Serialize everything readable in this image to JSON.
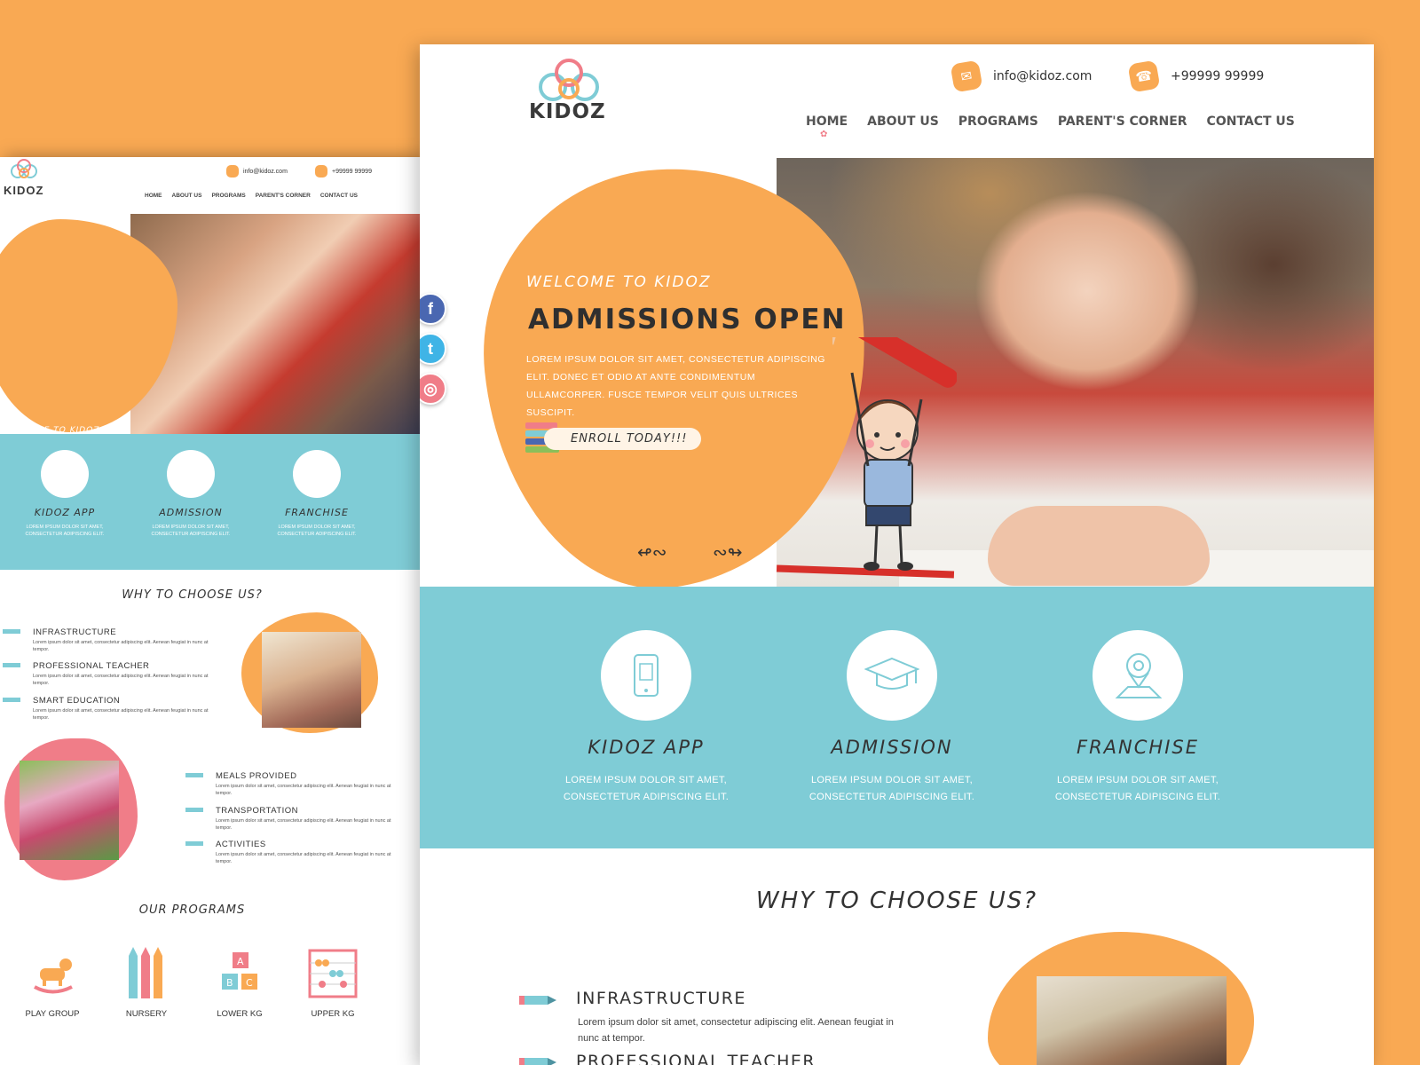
{
  "brand": {
    "name": "KIDOZ",
    "colors": {
      "accent": "#f9a953",
      "teal": "#7fccd6",
      "pink": "#f07d88"
    }
  },
  "contact": {
    "email": "info@kidoz.com",
    "phone": "+99999 99999",
    "email_icon": "mail-icon",
    "phone_icon": "phone-icon"
  },
  "nav": [
    {
      "label": "HOME",
      "active": true
    },
    {
      "label": "ABOUT US"
    },
    {
      "label": "PROGRAMS"
    },
    {
      "label": "PARENT'S CORNER"
    },
    {
      "label": "CONTACT US"
    }
  ],
  "hero": {
    "welcome": "WELCOME TO KIDOZ",
    "title": "ADMISSIONS OPEN",
    "description": "LOREM IPSUM DOLOR SIT AMET, CONSECTETUR ADIPISCING ELIT. DONEC ET ODIO AT ANTE CONDIMENTUM ULLAMCORPER. FUSCE TEMPOR VELIT QUIS ULTRICES SUSCIPIT.",
    "cta": "ENROLL TODAY!!!"
  },
  "social": [
    {
      "name": "facebook-icon",
      "glyph": "f",
      "color": "#4a67b1"
    },
    {
      "name": "twitter-icon",
      "glyph": "t",
      "color": "#3fb4e6"
    },
    {
      "name": "instagram-icon",
      "glyph": "◎",
      "color": "#f07d88"
    }
  ],
  "features": [
    {
      "title": "KIDOZ APP",
      "desc": "LOREM IPSUM DOLOR SIT AMET, CONSECTETUR ADIPISCING ELIT.",
      "icon": "mobile-app-icon"
    },
    {
      "title": "ADMISSION",
      "desc": "LOREM IPSUM DOLOR SIT AMET, CONSECTETUR ADIPISCING ELIT.",
      "icon": "graduation-cap-icon"
    },
    {
      "title": "FRANCHISE",
      "desc": "LOREM IPSUM DOLOR SIT AMET, CONSECTETUR ADIPISCING ELIT.",
      "icon": "map-pin-icon"
    }
  ],
  "why": {
    "title": "WHY TO CHOOSE US?",
    "items": [
      {
        "title": "INFRASTRUCTURE",
        "desc": "Lorem ipsum dolor sit amet, consectetur adipiscing elit. Aenean feugiat in nunc at tempor."
      },
      {
        "title": "PROFESSIONAL TEACHER",
        "desc": "Lorem ipsum dolor sit amet, consectetur adipiscing elit. Aenean feugiat in nunc at tempor."
      },
      {
        "title": "SMART EDUCATION",
        "desc": "Lorem ipsum dolor sit amet, consectetur adipiscing elit. Aenean feugiat in nunc at tempor."
      },
      {
        "title": "MEALS PROVIDED",
        "desc": "Lorem ipsum dolor sit amet, consectetur adipiscing elit. Aenean feugiat in nunc at tempor."
      },
      {
        "title": "TRANSPORTATION",
        "desc": "Lorem ipsum dolor sit amet, consectetur adipiscing elit. Aenean feugiat in nunc at tempor."
      },
      {
        "title": "ACTIVITIES",
        "desc": "Lorem ipsum dolor sit amet, consectetur adipiscing elit. Aenean feugiat in nunc at tempor."
      }
    ]
  },
  "programs": {
    "title": "OUR PROGRAMS",
    "items": [
      {
        "label": "PLAY GROUP",
        "icon": "rocking-horse-icon"
      },
      {
        "label": "NURSERY",
        "icon": "crayons-icon"
      },
      {
        "label": "LOWER KG",
        "icon": "abc-blocks-icon"
      },
      {
        "label": "UPPER KG",
        "icon": "abacus-icon"
      }
    ]
  }
}
